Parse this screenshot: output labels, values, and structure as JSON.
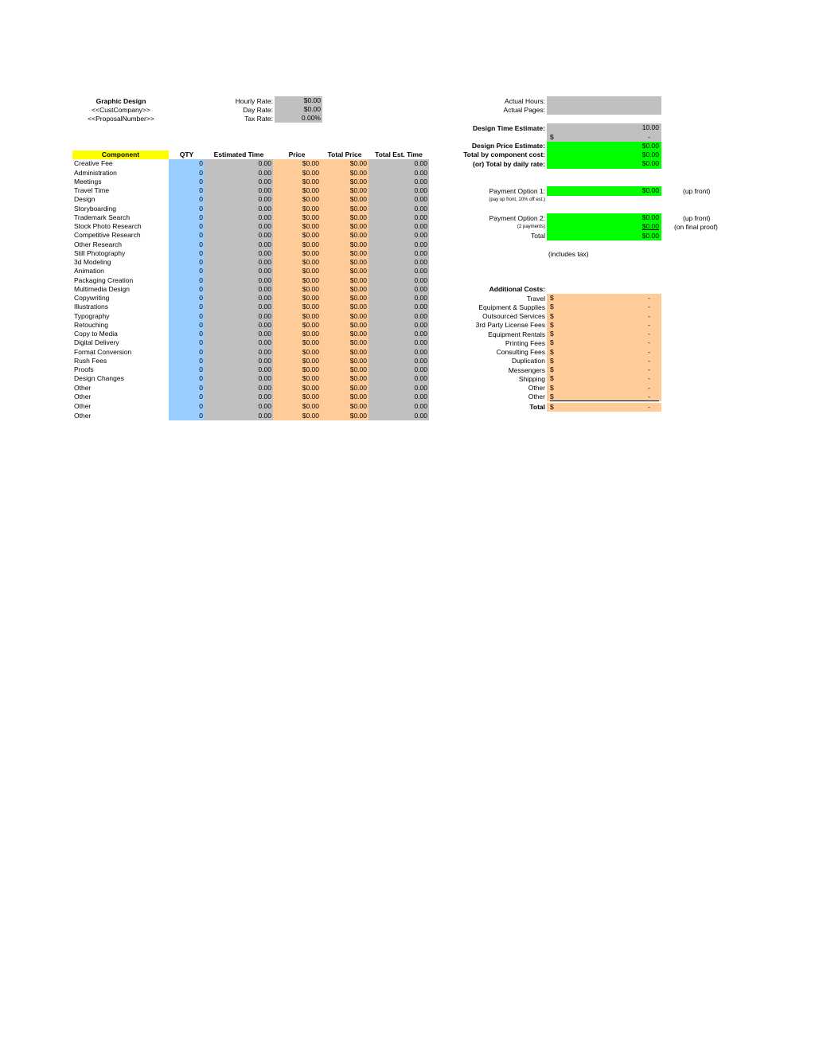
{
  "header": {
    "title": "Graphic Design",
    "company": "<<CustCompany>>",
    "proposal": "<<ProposalNumber>>"
  },
  "rates": [
    {
      "label": "Hourly Rate:",
      "value": "$0.00"
    },
    {
      "label": "Day Rate:",
      "value": "$0.00"
    },
    {
      "label": "Tax Rate:",
      "value": "0.00%"
    }
  ],
  "colors": {
    "qty": "#99ccff",
    "time": "#c0c0c0",
    "price": "#ffcc99",
    "total": "#00ff00",
    "header_highlight": "#ffff00"
  },
  "table": {
    "columns": [
      "Component",
      "QTY",
      "Estimated Time",
      "Price",
      "Total Price",
      "Total Est. Time"
    ],
    "rows": [
      {
        "name": "Creative Fee",
        "qty": "0",
        "est": "0.00",
        "price": "$0.00",
        "total": "$0.00",
        "total_time": "0.00"
      },
      {
        "name": "Administration",
        "qty": "0",
        "est": "0.00",
        "price": "$0.00",
        "total": "$0.00",
        "total_time": "0.00"
      },
      {
        "name": "Meetings",
        "qty": "0",
        "est": "0.00",
        "price": "$0.00",
        "total": "$0.00",
        "total_time": "0.00"
      },
      {
        "name": "Travel Time",
        "qty": "0",
        "est": "0.00",
        "price": "$0.00",
        "total": "$0.00",
        "total_time": "0.00"
      },
      {
        "name": "Design",
        "qty": "0",
        "est": "0.00",
        "price": "$0.00",
        "total": "$0.00",
        "total_time": "0.00"
      },
      {
        "name": "Storyboarding",
        "qty": "0",
        "est": "0.00",
        "price": "$0.00",
        "total": "$0.00",
        "total_time": "0.00"
      },
      {
        "name": "Trademark Search",
        "qty": "0",
        "est": "0.00",
        "price": "$0.00",
        "total": "$0.00",
        "total_time": "0.00"
      },
      {
        "name": "Stock Photo Research",
        "qty": "0",
        "est": "0.00",
        "price": "$0.00",
        "total": "$0.00",
        "total_time": "0.00"
      },
      {
        "name": "Competitive Research",
        "qty": "0",
        "est": "0.00",
        "price": "$0.00",
        "total": "$0.00",
        "total_time": "0.00"
      },
      {
        "name": "Other Research",
        "qty": "0",
        "est": "0.00",
        "price": "$0.00",
        "total": "$0.00",
        "total_time": "0.00"
      },
      {
        "name": "Still Photography",
        "qty": "0",
        "est": "0.00",
        "price": "$0.00",
        "total": "$0.00",
        "total_time": "0.00"
      },
      {
        "name": "3d Modeling",
        "qty": "0",
        "est": "0.00",
        "price": "$0.00",
        "total": "$0.00",
        "total_time": "0.00"
      },
      {
        "name": "Animation",
        "qty": "0",
        "est": "0.00",
        "price": "$0.00",
        "total": "$0.00",
        "total_time": "0.00"
      },
      {
        "name": "Packaging Creation",
        "qty": "0",
        "est": "0.00",
        "price": "$0.00",
        "total": "$0.00",
        "total_time": "0.00"
      },
      {
        "name": "Multimedia Design",
        "qty": "0",
        "est": "0.00",
        "price": "$0.00",
        "total": "$0.00",
        "total_time": "0.00"
      },
      {
        "name": "Copywriting",
        "qty": "0",
        "est": "0.00",
        "price": "$0.00",
        "total": "$0.00",
        "total_time": "0.00"
      },
      {
        "name": "Illustrations",
        "qty": "0",
        "est": "0.00",
        "price": "$0.00",
        "total": "$0.00",
        "total_time": "0.00"
      },
      {
        "name": "Typography",
        "qty": "0",
        "est": "0.00",
        "price": "$0.00",
        "total": "$0.00",
        "total_time": "0.00"
      },
      {
        "name": "Retouching",
        "qty": "0",
        "est": "0.00",
        "price": "$0.00",
        "total": "$0.00",
        "total_time": "0.00"
      },
      {
        "name": "Copy to Media",
        "qty": "0",
        "est": "0.00",
        "price": "$0.00",
        "total": "$0.00",
        "total_time": "0.00"
      },
      {
        "name": "Digital Delivery",
        "qty": "0",
        "est": "0.00",
        "price": "$0.00",
        "total": "$0.00",
        "total_time": "0.00"
      },
      {
        "name": "Format Conversion",
        "qty": "0",
        "est": "0.00",
        "price": "$0.00",
        "total": "$0.00",
        "total_time": "0.00"
      },
      {
        "name": "Rush Fees",
        "qty": "0",
        "est": "0.00",
        "price": "$0.00",
        "total": "$0.00",
        "total_time": "0.00"
      },
      {
        "name": "Proofs",
        "qty": "0",
        "est": "0.00",
        "price": "$0.00",
        "total": "$0.00",
        "total_time": "0.00"
      },
      {
        "name": "Design Changes",
        "qty": "0",
        "est": "0.00",
        "price": "$0.00",
        "total": "$0.00",
        "total_time": "0.00"
      },
      {
        "name": "Other",
        "qty": "0",
        "est": "0.00",
        "price": "$0.00",
        "total": "$0.00",
        "total_time": "0.00"
      },
      {
        "name": "Other",
        "qty": "0",
        "est": "0.00",
        "price": "$0.00",
        "total": "$0.00",
        "total_time": "0.00"
      },
      {
        "name": "Other",
        "qty": "0",
        "est": "0.00",
        "price": "$0.00",
        "total": "$0.00",
        "total_time": "0.00"
      },
      {
        "name": "Other",
        "qty": "0",
        "est": "0.00",
        "price": "$0.00",
        "total": "$0.00",
        "total_time": "0.00"
      }
    ]
  },
  "actuals": {
    "hours_label": "Actual Hours:",
    "hours_value": "",
    "pages_label": "Actual Pages:",
    "pages_value": ""
  },
  "estimates": {
    "time_label": "Design Time Estimate:",
    "time_value": "10.00",
    "time_sub_currency": "$",
    "time_sub_value": "-",
    "price_label": "Design Price Estimate:",
    "price_value": "$0.00",
    "component_label": "Total by component cost:",
    "component_value": "$0.00",
    "daily_label": "(or) Total by daily rate:",
    "daily_value": "$0.00"
  },
  "payment": {
    "option1_label": "Payment Option 1:",
    "option1_value": "$0.00",
    "option1_note": "(up front)",
    "option1_sub": "(pay up front, 10% off est.)",
    "option2_label": "Payment Option 2:",
    "option2_value1": "$0.00",
    "option2_note1": "(up front)",
    "option2_sub": "(2 payments)",
    "option2_value2": "$0.00",
    "option2_note2": "(on final proof)",
    "total_label": "Total",
    "total_value": "$0.00",
    "tax_note": "(includes tax)"
  },
  "additional": {
    "title": "Additional Costs:",
    "items": [
      {
        "label": "Travel",
        "currency": "$",
        "value": "-"
      },
      {
        "label": "Equipment & Supplies",
        "currency": "$",
        "value": "-"
      },
      {
        "label": "Outsourced Services",
        "currency": "$",
        "value": "-"
      },
      {
        "label": "3rd Party License Fees",
        "currency": "$",
        "value": "-"
      },
      {
        "label": "Equipment Rentals",
        "currency": "$",
        "value": "-"
      },
      {
        "label": "Printing Fees",
        "currency": "$",
        "value": "-"
      },
      {
        "label": "Consulting Fees",
        "currency": "$",
        "value": "-"
      },
      {
        "label": "Duplication",
        "currency": "$",
        "value": "-"
      },
      {
        "label": "Messengers",
        "currency": "$",
        "value": "-"
      },
      {
        "label": "Shipping",
        "currency": "$",
        "value": "-"
      },
      {
        "label": "Other",
        "currency": "$",
        "value": "-"
      },
      {
        "label": "Other",
        "currency": "$",
        "value": "-"
      }
    ],
    "total_label": "Total",
    "total_currency": "$",
    "total_value": "-"
  }
}
